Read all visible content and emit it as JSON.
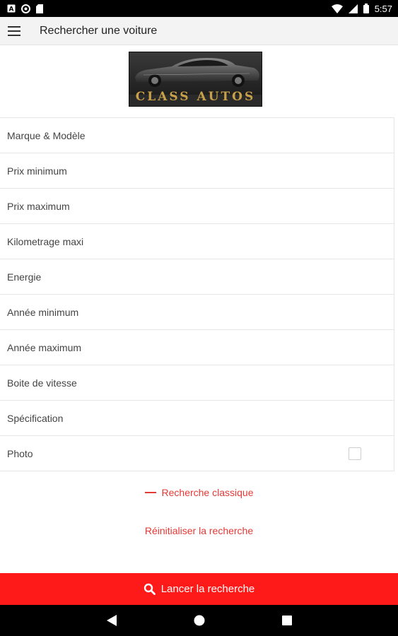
{
  "status_bar": {
    "time": "5:57",
    "left_icons": [
      "app-a-icon",
      "record-icon",
      "sd-card-icon"
    ],
    "right_icons": [
      "wifi-icon",
      "signal-icon",
      "battery-icon"
    ]
  },
  "app_bar": {
    "title": "Rechercher une voiture",
    "menu_icon": "hamburger-menu-icon"
  },
  "logo": {
    "text": "CLASS AUTOS"
  },
  "form": {
    "fields": [
      {
        "label": "Marque & Modèle"
      },
      {
        "label": "Prix minimum"
      },
      {
        "label": "Prix maximum"
      },
      {
        "label": "Kilometrage maxi"
      },
      {
        "label": "Energie"
      },
      {
        "label": "Année minimum"
      },
      {
        "label": "Année maximum"
      },
      {
        "label": "Boite de vitesse"
      },
      {
        "label": "Spécification"
      },
      {
        "label": "Photo",
        "checked": false
      }
    ]
  },
  "links": {
    "classic_search": "Recherche classique",
    "reset_search": "Réinitialiser la recherche"
  },
  "launch_button": {
    "label": "Lancer la recherche",
    "icon": "search-icon"
  },
  "nav_bar": {
    "buttons": [
      "back-icon",
      "home-icon",
      "recents-icon"
    ]
  },
  "colors": {
    "accent": "#e53935",
    "launch_button": "#ff1a1a",
    "app_bar_bg": "#f3f3f3",
    "logo_gold": "#c9a04a"
  }
}
